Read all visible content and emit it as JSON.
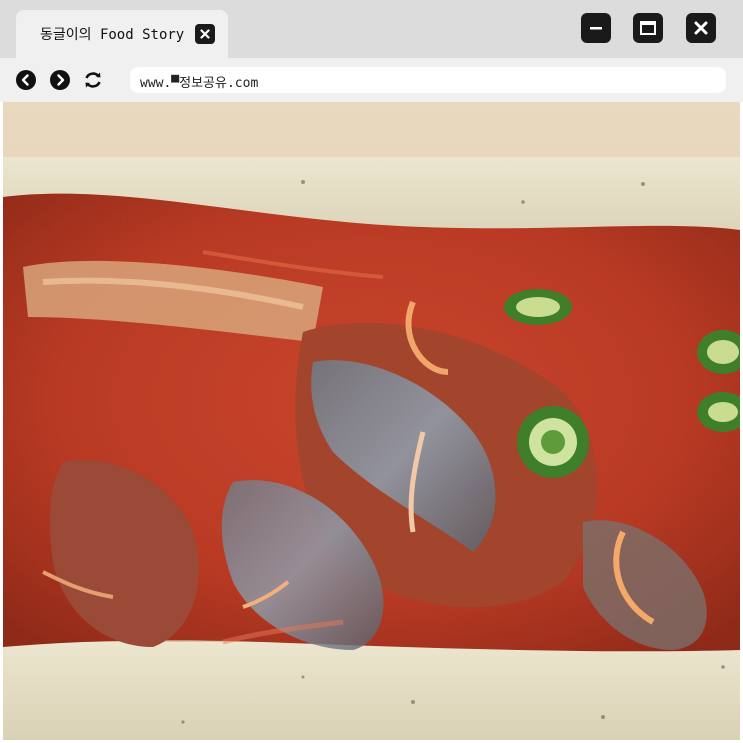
{
  "tab": {
    "title": "동글이의 Food Story",
    "close_icon": "close-icon"
  },
  "window_controls": {
    "minimize_icon": "minimize-icon",
    "maximize_icon": "maximize-icon",
    "close_icon": "close-icon"
  },
  "nav": {
    "back_icon": "back-arrow-icon",
    "forward_icon": "forward-arrow-icon",
    "reload_icon": "reload-icon"
  },
  "address_bar": {
    "url": "www.▀정보공유.com"
  },
  "content": {
    "image_subject": "braised mackerel with radish in red chili sauce on a ceramic dish"
  },
  "colors": {
    "titlebar_bg": "#dcdcdc",
    "tab_bg": "#f0f0f0",
    "button_dark": "#1a1a1a",
    "sauce_red": "#c8402a"
  }
}
